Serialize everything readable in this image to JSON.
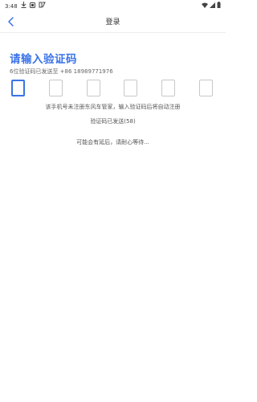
{
  "status_bar": {
    "time": "3:48",
    "left_icons": [
      "download-icon",
      "notification-icon",
      "app-icon"
    ],
    "right_icons": [
      "wifi-icon",
      "signal-icon",
      "battery-icon"
    ]
  },
  "nav": {
    "title": "登录",
    "back_icon": "chevron-left-icon"
  },
  "page": {
    "heading": "请输入验证码",
    "sent_to": "6位验证码已发送至 +86 18989771976",
    "code_boxes": [
      "",
      "",
      "",
      "",
      "",
      ""
    ],
    "active_box_index": 0,
    "register_notice": "该手机号未注册东风车管家，输入验证码后将自动注册",
    "countdown": "验证码已发送(58)",
    "wait_notice": "可能会有延后，请耐心等待..."
  },
  "colors": {
    "accent": "#3a73e8",
    "box_border": "#c8c8c8",
    "text": "#333333",
    "muted": "#666666"
  }
}
